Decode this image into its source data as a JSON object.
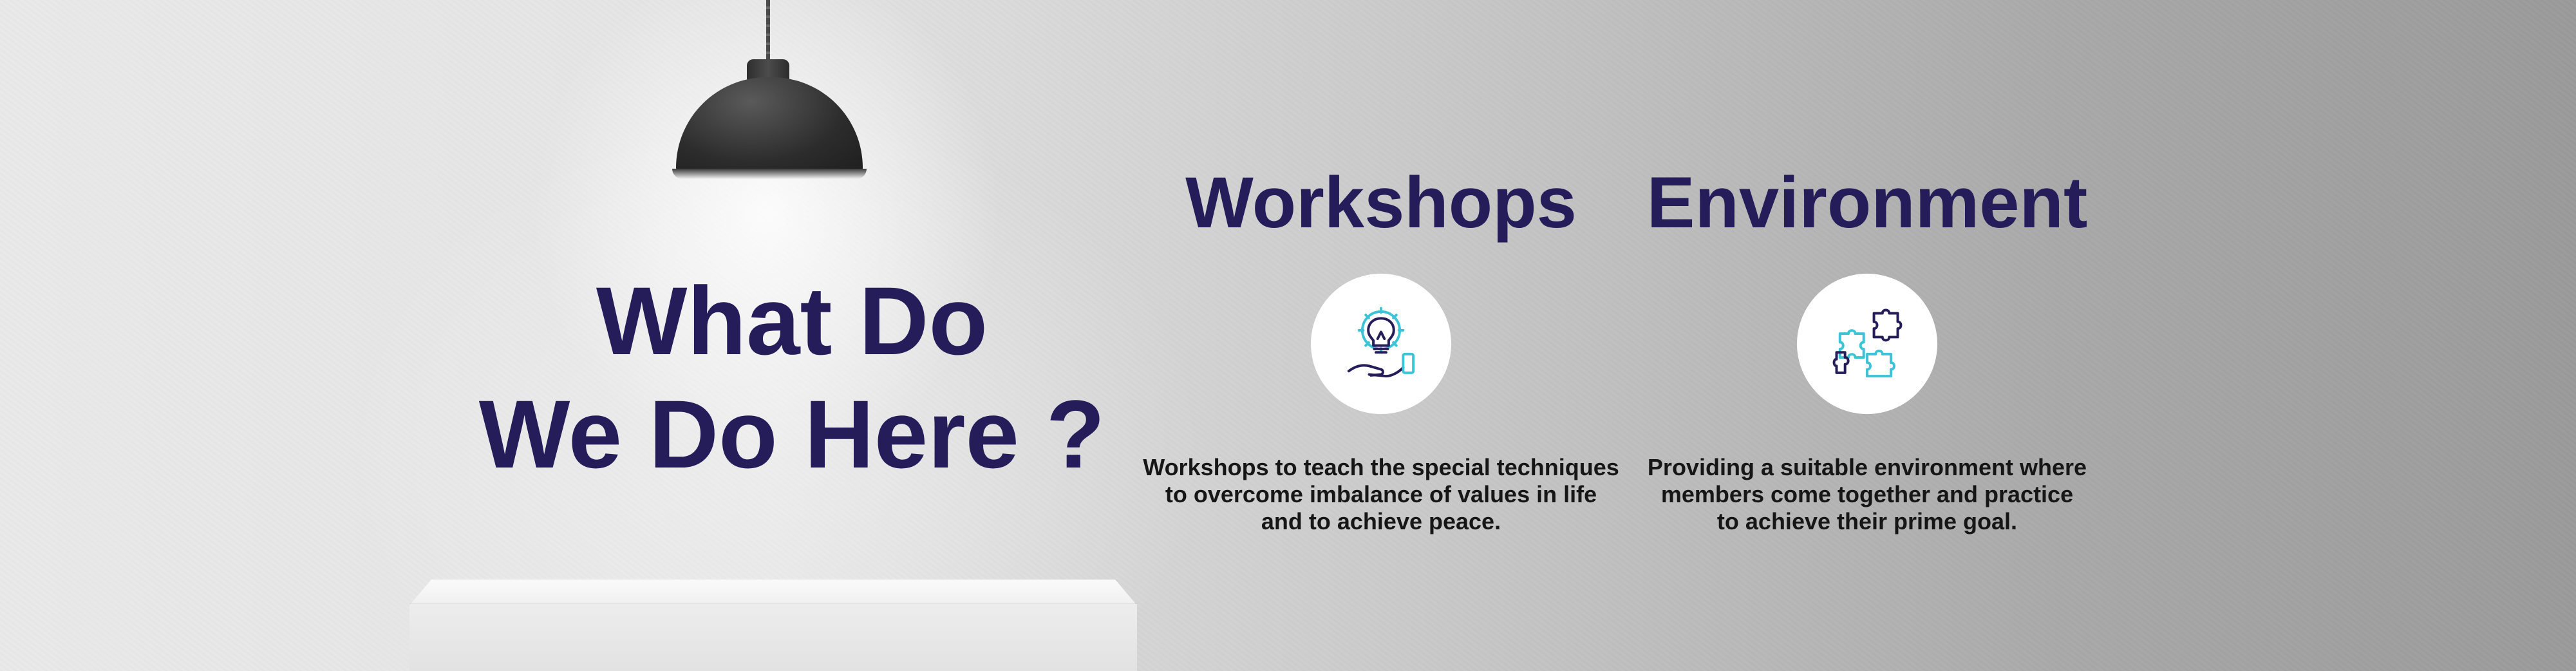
{
  "headline": {
    "line1": "What Do",
    "line2": "We Do Here ?"
  },
  "features": [
    {
      "title": "Workshops",
      "icon": "lightbulb-gear-hand-icon",
      "description": "Workshops to teach the special techniques\nto overcome imbalance of values in life\nand to achieve peace."
    },
    {
      "title": "Environment",
      "icon": "puzzle-pieces-icon",
      "description": "Providing a suitable environment where\nmembers come together and practice\nto achieve their prime goal."
    }
  ],
  "colors": {
    "heading": "#241d59",
    "accent": "#3cc3d8",
    "body_text": "#161616"
  }
}
